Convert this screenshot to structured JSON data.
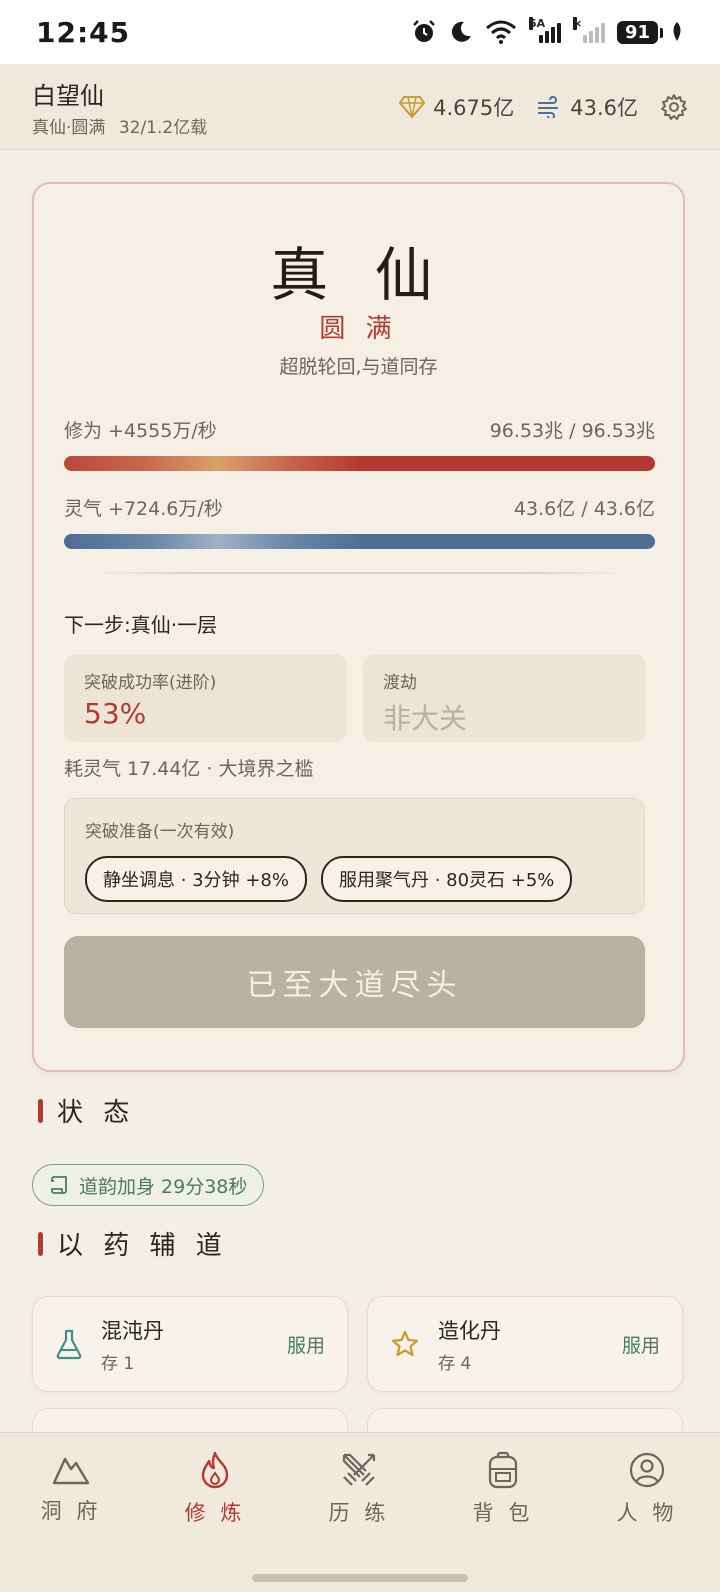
{
  "status_bar": {
    "time": "12:45",
    "network_tag": "5A",
    "battery": "91"
  },
  "header": {
    "player_name": "白望仙",
    "player_sub": "真仙·圆满",
    "player_progress": "32/1.2亿载",
    "spirit_stones": "4.675亿",
    "qi": "43.6亿",
    "icons": {
      "stone": "diamond-icon",
      "qi": "wind-icon",
      "settings": "gear-icon"
    }
  },
  "realm": {
    "title": "真 仙",
    "stage": "圆 满",
    "desc": "超脱轮回,与道同存"
  },
  "xiuwei": {
    "label": "修为 +4555万/秒",
    "value": "96.53兆 / 96.53兆",
    "fraction": 1.0
  },
  "lingqi": {
    "label": "灵气 +724.6万/秒",
    "value": "43.6亿 / 43.6亿",
    "fraction": 1.0
  },
  "breakthrough": {
    "next_step": "下一步:真仙·一层",
    "rate_label": "突破成功率(进阶)",
    "rate_value": "53%",
    "tribulation_label": "渡劫",
    "tribulation_value": "非大关",
    "cost": "耗灵气 17.44亿 · 大境界之槛",
    "prep_label": "突破准备(一次有效)",
    "prep_options": [
      "静坐调息 · 3分钟 +8%",
      "服用聚气丹 · 80灵石 +5%"
    ],
    "button": "已至大道尽头"
  },
  "status_section": {
    "title": "状 态",
    "chip": "道韵加身 29分38秒"
  },
  "pills_section": {
    "title": "以 药 辅 道",
    "items": [
      {
        "name": "混沌丹",
        "count": "存 1",
        "action": "服用",
        "icon": "flask-icon",
        "color": "#3f8f8a"
      },
      {
        "name": "造化丹",
        "count": "存 4",
        "action": "服用",
        "icon": "star-icon",
        "color": "#c99a2e"
      }
    ]
  },
  "bottom_nav": {
    "active": 1,
    "items": [
      {
        "label": "洞 府",
        "icon": "mountain-icon"
      },
      {
        "label": "修 炼",
        "icon": "flame-icon"
      },
      {
        "label": "历 练",
        "icon": "swords-icon"
      },
      {
        "label": "背 包",
        "icon": "backpack-icon"
      },
      {
        "label": "人 物",
        "icon": "person-icon"
      }
    ]
  },
  "colors": {
    "accent": "#b23a32",
    "jade": "#4c7a63",
    "qi_blue": "#4f6e96",
    "background": "#f4efe6"
  }
}
